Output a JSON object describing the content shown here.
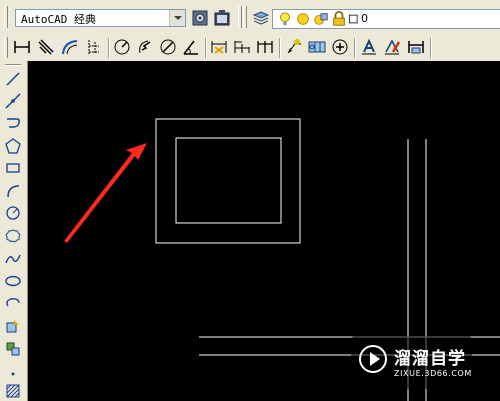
{
  "workspace": {
    "value": "AutoCAD 经典"
  },
  "layer": {
    "current": "0"
  },
  "watermark": {
    "title": "溜溜自学",
    "url": "ZIXUE.3D66.COM"
  },
  "colors": {
    "toolbar_bg": "#ece9d8",
    "canvas_bg": "#000000",
    "line": "#ffffff",
    "arrow": "#ff2a1a"
  },
  "icons": {
    "toolbar_top": [
      "workspace-settings-icon",
      "workspace-toggle-icon",
      "layer-manager-icon",
      "layer-on-bulb-icon",
      "layer-freeze-sun-icon",
      "layer-vp-freeze-icon",
      "layer-lock-icon",
      "layer-color-icon"
    ],
    "toolbar_dim": [
      "linear-dimension-icon",
      "aligned-dimension-icon",
      "arc-length-icon",
      "ordinate-dimension-icon",
      "radius-dimension-icon",
      "jogged-radius-icon",
      "diameter-dimension-icon",
      "angular-dimension-icon",
      "quick-dimension-icon",
      "baseline-dimension-icon",
      "continue-dimension-icon",
      "quick-leader-icon",
      "tolerance-icon",
      "center-mark-icon",
      "dimension-edit-icon",
      "dimension-text-edit-icon",
      "dimension-update-icon"
    ],
    "draw_panel": [
      "line-icon",
      "construction-line-icon",
      "polyline-icon",
      "polygon-icon",
      "rectangle-icon",
      "arc-icon",
      "circle-icon",
      "revision-cloud-icon",
      "spline-icon",
      "ellipse-icon",
      "ellipse-arc-icon",
      "insert-block-icon",
      "make-block-icon",
      "point-icon",
      "hatch-icon"
    ]
  }
}
